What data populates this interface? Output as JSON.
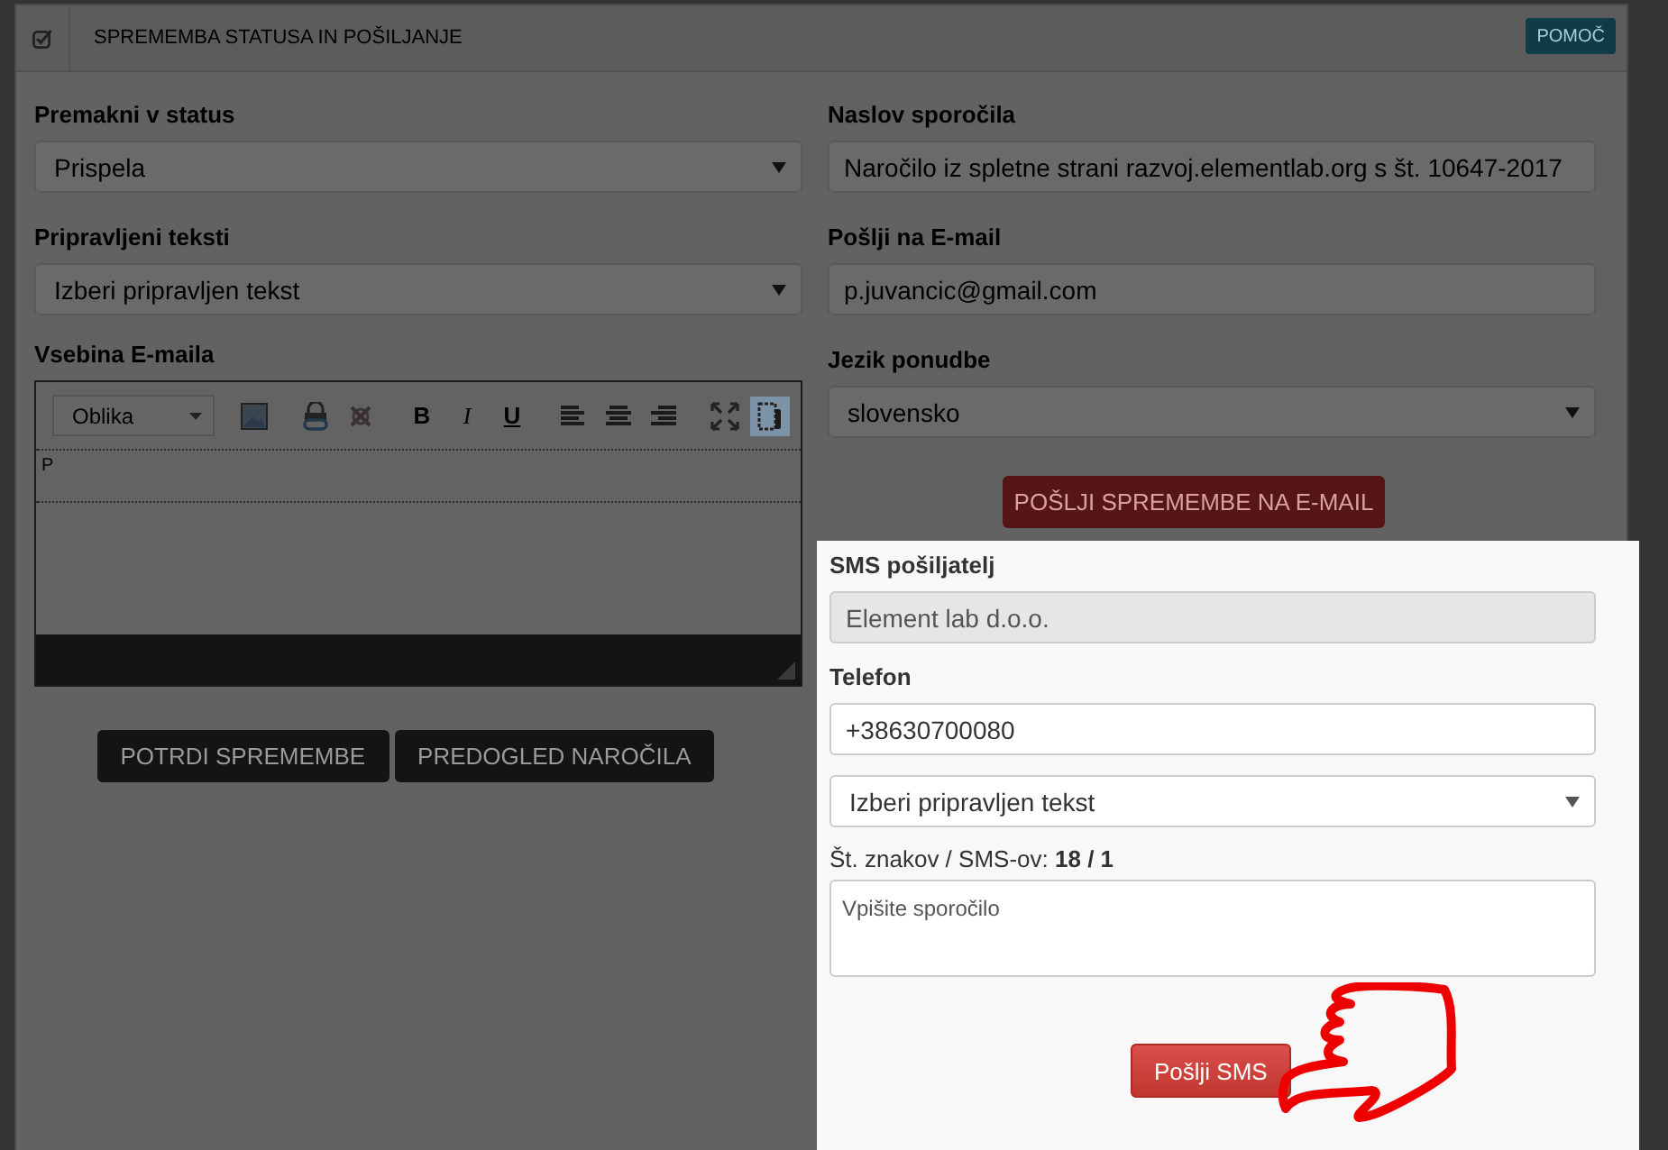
{
  "header": {
    "title": "SPREMEMBA STATUSA IN POŠILJANJE",
    "help_button": "POMOČ"
  },
  "left_fields": [
    {
      "kind": "select",
      "label": "Premakni v status",
      "value": "Prispela"
    },
    {
      "kind": "select",
      "label": "Pripravljeni teksti",
      "value": "Izberi pripravljen tekst"
    }
  ],
  "editor": {
    "label": "Vsebina E-maila",
    "format_select": "Oblika",
    "letters": [
      "B",
      "I",
      "U"
    ],
    "show_blocks_active": true,
    "path": "P"
  },
  "left_buttons": [
    "POTRDI SPREMEMBE",
    "PREDOGLED NAROČILA"
  ],
  "right_fields": [
    {
      "kind": "input",
      "label": "Naslov sporočila",
      "value": "Naročilo iz spletne strani razvoj.elementlab.org s št. 10647-2017"
    },
    {
      "kind": "input",
      "label": "Pošlji na E-mail",
      "value": "p.juvancic@gmail.com"
    },
    {
      "kind": "select",
      "label": "Jezik ponudbe",
      "value": "slovensko"
    }
  ],
  "email_button": "POŠLJI SPREMEMBE NA E-MAIL",
  "sms": {
    "fields": [
      {
        "kind": "input",
        "label": "SMS pošiljatelj",
        "value": "Element lab d.o.o.",
        "disabled": true
      },
      {
        "kind": "input",
        "label": "Telefon",
        "value": "+38630700080",
        "disabled": false
      },
      {
        "kind": "select",
        "value": "Izberi pripravljen tekst",
        "disabled": false
      }
    ],
    "counter": "Št. znakov / SMS-ov: **18 / 1**",
    "message_placeholder": "Vpišite sporočilo",
    "send_button": "Pošlji SMS"
  }
}
